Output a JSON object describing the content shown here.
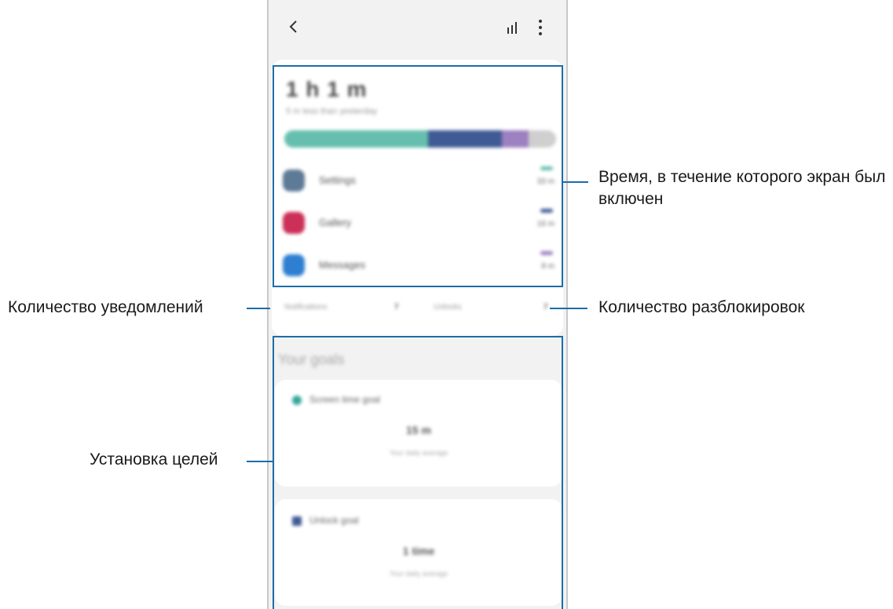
{
  "appbar": {
    "back_icon": "chevron-left-icon",
    "chart_icon": "bar-chart-icon",
    "more_icon": "vertical-dots-icon"
  },
  "summary": {
    "total_time": "1 h 1 m",
    "compare_text": "5 m less than yesterday",
    "bar_segments": [
      {
        "color": "#66bfae",
        "fraction": 0.53
      },
      {
        "color": "#3f5a94",
        "fraction": 0.27
      },
      {
        "color": "#9d80c0",
        "fraction": 0.1
      },
      {
        "color": "#cfcfcf",
        "fraction": 0.1
      }
    ]
  },
  "apps": [
    {
      "name": "Settings",
      "time": "33 m",
      "icon_color": "#5d7a96",
      "dash_color": "#66bfae",
      "icon": "gear-icon"
    },
    {
      "name": "Gallery",
      "time": "16 m",
      "icon_color": "#cc2f58",
      "dash_color": "#3f5a94",
      "icon": "flower-icon"
    },
    {
      "name": "Messages",
      "time": "8 m",
      "icon_color": "#2e7fd1",
      "dash_color": "#9d80c0",
      "icon": "chat-bubble-icon"
    }
  ],
  "counts": {
    "notifications_label": "Notifications",
    "notifications_value": "7",
    "unlocks_label": "Unlocks",
    "unlocks_value": "7"
  },
  "goals": {
    "title": "Your goals",
    "screen_time": {
      "label": "Screen time goal",
      "value": "15 m",
      "sub": "Your daily average",
      "icon_color": "#2fa79a"
    },
    "unlock": {
      "label": "Unlock goal",
      "value": "1 time",
      "sub": "Your daily average",
      "icon_color": "#3f5a94"
    }
  },
  "callouts": {
    "screen_time": "Время, в течение которого экран был включен",
    "notifications": "Количество уведомлений",
    "unlocks": "Количество разблокировок",
    "goals": "Установка целей"
  },
  "colors": {
    "accent": "#1b6da8"
  }
}
